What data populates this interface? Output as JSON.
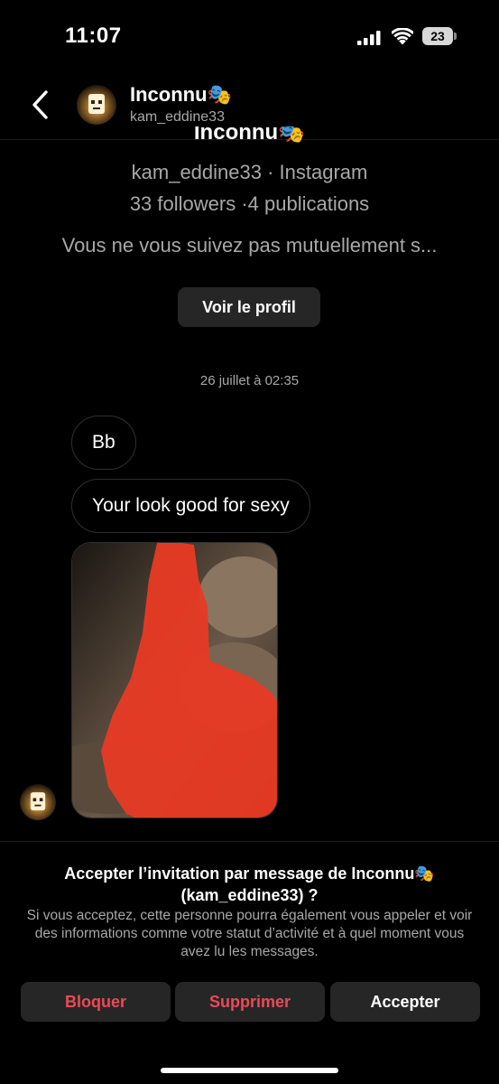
{
  "status_bar": {
    "time": "11:07",
    "battery": "23"
  },
  "header": {
    "name": "Inconnu🎭",
    "username": "kam_eddine33"
  },
  "profile": {
    "name": "Inconnu🎭",
    "subtitle": "kam_eddine33 · Instagram",
    "stats": "33 followers ·4 publications",
    "mutual": "Vous ne vous suivez pas mutuellement s...",
    "view_profile_label": "Voir le profil"
  },
  "thread": {
    "timestamp": "26 juillet à 02:35",
    "messages": [
      "Bb",
      "Your look good for sexy"
    ]
  },
  "request": {
    "title": "Accepter l’invitation par message de Inconnu🎭 (kam_eddine33) ?",
    "description": "Si vous acceptez, cette personne pourra également vous appeler et voir des informations comme votre statut d’activité et à quel moment vous avez lu les messages.",
    "block_label": "Bloquer",
    "delete_label": "Supprimer",
    "accept_label": "Accepter"
  },
  "colors": {
    "danger": "#ed4956",
    "button_bg": "#262626",
    "secondary_text": "#a8a8a8",
    "redaction": "#e63a24"
  },
  "icons": {
    "back": "chevron-left-icon",
    "signal": "cellular-signal-icon",
    "wifi": "wifi-icon",
    "battery": "battery-icon"
  }
}
